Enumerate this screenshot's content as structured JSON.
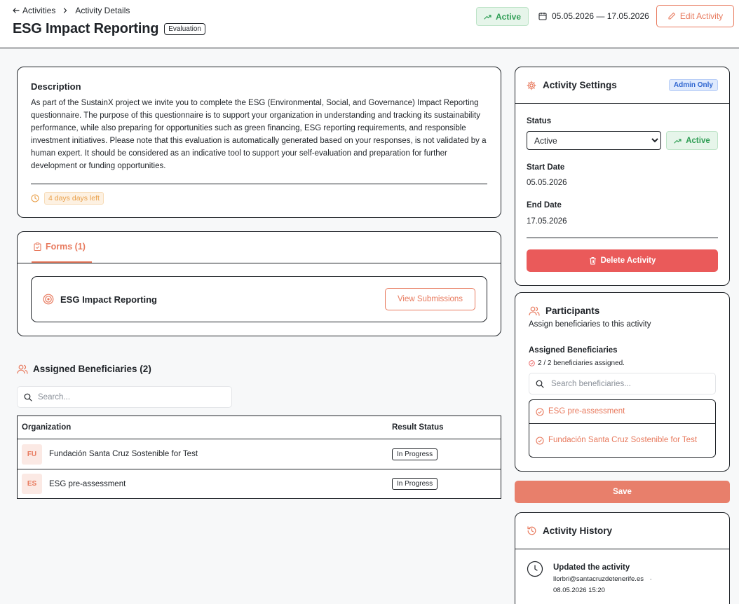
{
  "breadcrumb": {
    "back_label": "Activities",
    "current": "Activity Details"
  },
  "page": {
    "title": "ESG Impact Reporting",
    "type_badge": "Evaluation"
  },
  "header": {
    "status": "Active",
    "date_range": "05.05.2026 — 17.05.2026",
    "edit_label": "Edit Activity"
  },
  "description": {
    "heading": "Description",
    "text": "As part of the SustainX project we invite you to complete the ESG (Environmental, Social, and Governance) Impact Reporting questionnaire. The purpose of this questionnaire is to support your organization in understanding and tracking its sustainability performance, while also preparing for opportunities such as green financing, ESG reporting requirements, and responsible investment initiatives. Please note that this evaluation is automatically generated based on your responses, is not validated by a human expert. It should be considered as an indicative tool to support your self-evaluation and preparation for further development or funding opportunities.",
    "days_left": "4 days days left"
  },
  "forms": {
    "tab_label": "Forms (1)",
    "items": [
      {
        "name": "ESG Impact Reporting",
        "action": "View Submissions"
      }
    ]
  },
  "beneficiaries": {
    "heading": "Assigned Beneficiaries (2)",
    "search_placeholder": "Search...",
    "columns": {
      "org": "Organization",
      "status": "Result Status"
    },
    "rows": [
      {
        "initials": "FU",
        "name": "Fundación Santa Cruz Sostenible for Test",
        "status": "In Progress"
      },
      {
        "initials": "ES",
        "name": "ESG pre-assessment",
        "status": "In Progress"
      }
    ]
  },
  "settings": {
    "title": "Activity Settings",
    "admin_badge": "Admin Only",
    "status_label": "Status",
    "status_value": "Active",
    "status_chip": "Active",
    "start_label": "Start Date",
    "start_value": "05.05.2026",
    "end_label": "End Date",
    "end_value": "17.05.2026",
    "delete_label": "Delete Activity"
  },
  "participants": {
    "title": "Participants",
    "subtitle": "Assign beneficiaries to this activity",
    "assigned_label": "Assigned Beneficiaries",
    "assigned_count": "2 / 2 beneficiaries assigned.",
    "search_placeholder": "Search beneficiaries...",
    "items": [
      "ESG pre-assessment",
      "Fundación Santa Cruz Sostenible for Test"
    ]
  },
  "save_label": "Save",
  "history": {
    "title": "Activity History",
    "entries": [
      {
        "action": "Updated the activity",
        "user": "llorbri@santacruzdetenerife.es",
        "dot": "·",
        "time": "08.05.2026 15:20"
      }
    ]
  },
  "colors": {
    "accent": "#e87a5e",
    "success": "#2f9e55",
    "danger": "#ea5a5a",
    "info": "#2f66d0",
    "warning": "#e9a04a"
  },
  "icons": [
    "arrow-left-icon",
    "chevron-right-icon",
    "trend-up-icon",
    "calendar-icon",
    "pencil-icon",
    "clock-icon",
    "clipboard-icon",
    "target-icon",
    "users-icon",
    "search-icon",
    "gear-icon",
    "trash-icon",
    "check-circle-icon",
    "history-icon"
  ]
}
